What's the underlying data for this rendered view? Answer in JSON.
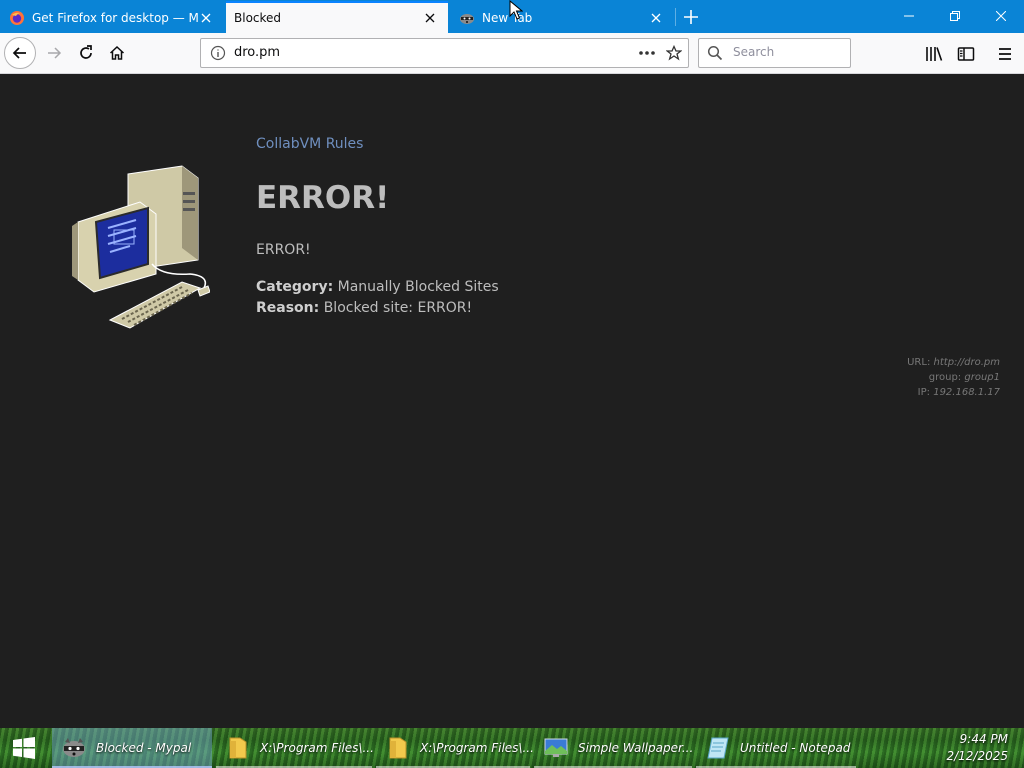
{
  "browser": {
    "tabs": [
      {
        "title": "Get Firefox for desktop — Mozilla",
        "active": false,
        "icon": "firefox-icon"
      },
      {
        "title": "Blocked",
        "active": true,
        "icon": "none"
      },
      {
        "title": "New Tab",
        "active": false,
        "icon": "raccoon-icon"
      }
    ],
    "address": "dro.pm",
    "search_placeholder": "Search"
  },
  "page": {
    "brand": "CollabVM Rules",
    "heading": "ERROR!",
    "message": "ERROR!",
    "category_label": "Category:",
    "category_value": "Manually Blocked Sites",
    "reason_label": "Reason:",
    "reason_value": "Blocked site: ERROR!",
    "meta": {
      "url_label": "URL:",
      "url_value": "http://dro.pm",
      "group_label": "group:",
      "group_value": "group1",
      "ip_label": "IP:",
      "ip_value": "192.168.1.17"
    }
  },
  "taskbar": {
    "tasks": [
      {
        "label": "Blocked - Mypal",
        "active": true,
        "icon": "raccoon-icon"
      },
      {
        "label": "X:\\Program Files\\...",
        "active": false,
        "icon": "folder-icon"
      },
      {
        "label": "X:\\Program Files\\...",
        "active": false,
        "icon": "folder-icon"
      },
      {
        "label": "Simple Wallpaper...",
        "active": false,
        "icon": "wallpaper-icon"
      },
      {
        "label": "Untitled - Notepad",
        "active": false,
        "icon": "notepad-icon"
      }
    ],
    "time": "9:44 PM",
    "date": "2/12/2025"
  },
  "colors": {
    "tabstrip": "#0a84d6",
    "page_bg": "#1f1f1f",
    "brand_link": "#6f8fbf"
  }
}
